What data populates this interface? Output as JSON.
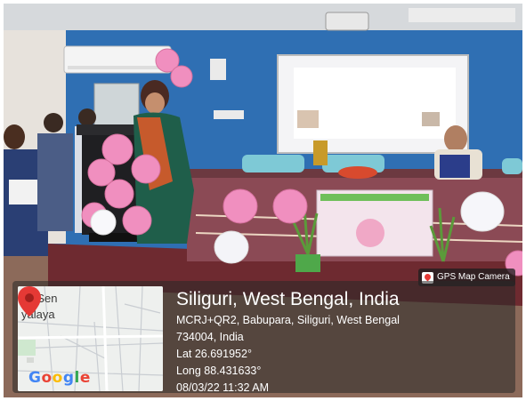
{
  "photo": {
    "subject": "speaker at lectern in seminar hall with pink balloons"
  },
  "geo_overlay": {
    "badge": "GPS Map Camera",
    "location": "Siliguri, West Bengal, India",
    "address_line1": "MCRJ+QR2, Babupara, Siliguri, West Bengal",
    "address_line2": "734004, India",
    "lat": "Lat 26.691952°",
    "long": "Long 88.431633°",
    "datetime": "08/03/22 11:32 AM"
  },
  "map": {
    "label_line1": "ya Sen",
    "label_line2": "yalaya",
    "logo": "Google",
    "pin_color": "#e53935"
  },
  "colors": {
    "wall": "#2f6fb3",
    "stage": "#7a2f36",
    "balloon": "#f08fbf",
    "panel": "#282828"
  }
}
